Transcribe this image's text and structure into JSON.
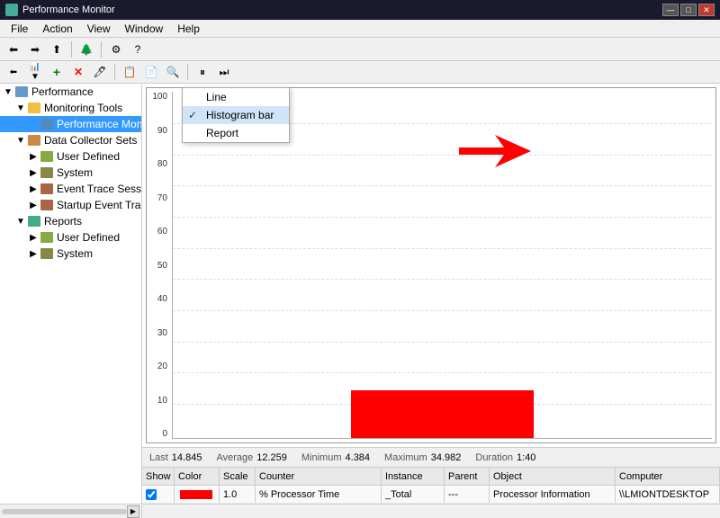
{
  "window": {
    "title": "Performance Monitor"
  },
  "menubar": {
    "items": [
      "File",
      "Action",
      "View",
      "Window",
      "Help"
    ]
  },
  "sidebar": {
    "tree": [
      {
        "id": "performance",
        "label": "Performance",
        "level": 0,
        "icon": "computer",
        "expanded": true
      },
      {
        "id": "monitoring-tools",
        "label": "Monitoring Tools",
        "level": 1,
        "icon": "folder",
        "expanded": true
      },
      {
        "id": "performance-monitor",
        "label": "Performance Monitor",
        "level": 2,
        "icon": "monitor",
        "selected": true
      },
      {
        "id": "data-collector-sets",
        "label": "Data Collector Sets",
        "level": 1,
        "icon": "dataset",
        "expanded": true
      },
      {
        "id": "user-defined",
        "label": "User Defined",
        "level": 2,
        "icon": "folder"
      },
      {
        "id": "system",
        "label": "System",
        "level": 2,
        "icon": "folder"
      },
      {
        "id": "event-trace-sessions",
        "label": "Event Trace Sessions",
        "level": 2,
        "icon": "event"
      },
      {
        "id": "startup-event-trace",
        "label": "Startup Event Trace Sess",
        "level": 2,
        "icon": "event"
      },
      {
        "id": "reports",
        "label": "Reports",
        "level": 1,
        "icon": "report",
        "expanded": true
      },
      {
        "id": "reports-user-defined",
        "label": "User Defined",
        "level": 2,
        "icon": "folder"
      },
      {
        "id": "reports-system",
        "label": "System",
        "level": 2,
        "icon": "folder"
      }
    ]
  },
  "dropdown": {
    "items": [
      {
        "label": "Line",
        "checked": false
      },
      {
        "label": "Histogram bar",
        "checked": true
      },
      {
        "label": "Report",
        "checked": false
      }
    ]
  },
  "stats": {
    "last_label": "Last",
    "last_value": "14.845",
    "average_label": "Average",
    "average_value": "12.259",
    "minimum_label": "Minimum",
    "minimum_value": "4.384",
    "maximum_label": "Maximum",
    "maximum_value": "34.982",
    "duration_label": "Duration",
    "duration_value": "1:40"
  },
  "chart": {
    "y_labels": [
      "100",
      "90",
      "80",
      "70",
      "60",
      "50",
      "40",
      "30",
      "20",
      "10",
      "0"
    ],
    "bar_left_pct": 33,
    "bar_width_pct": 34,
    "bar_height_pct": 14
  },
  "counter_table": {
    "headers": [
      "Show",
      "Color",
      "Scale",
      "Counter",
      "Instance",
      "Parent",
      "Object",
      "Computer"
    ],
    "rows": [
      {
        "show": "✓",
        "color": "red",
        "scale": "1.0",
        "counter": "% Processor Time",
        "instance": "_Total",
        "parent": "---",
        "object": "Processor Information",
        "computer": "\\\\LMIONTDESKTOP"
      }
    ]
  },
  "titlebar": {
    "controls": [
      "—",
      "□",
      "✕"
    ]
  }
}
